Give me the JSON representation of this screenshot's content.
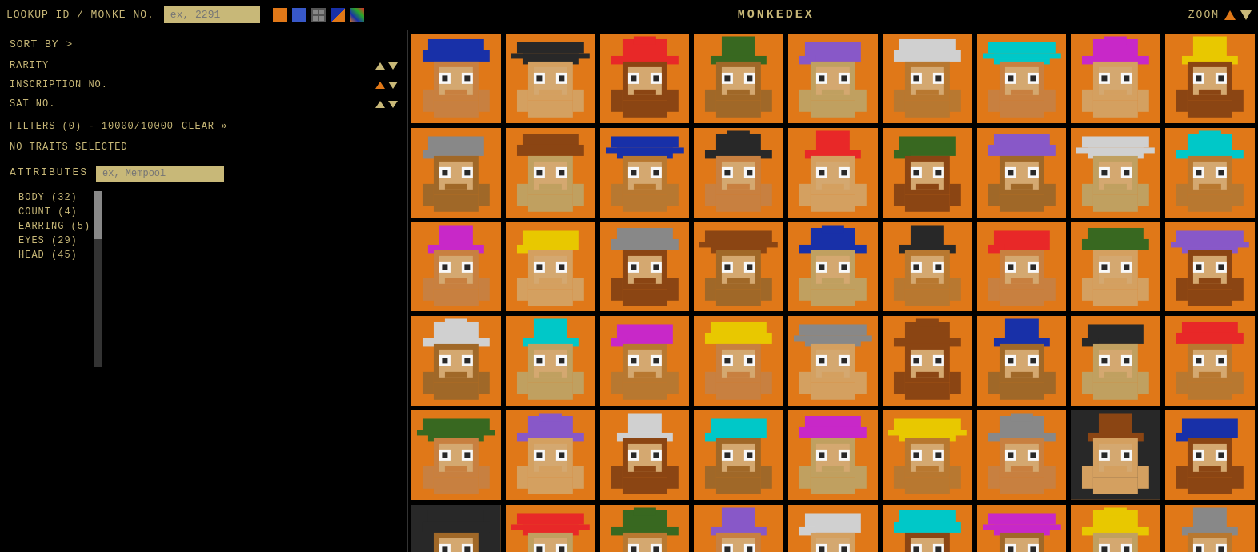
{
  "header": {
    "lookup_label": "LOOKUP ID / MONKE NO.",
    "lookup_placeholder": "ex, 2291",
    "monkedex_label": "MONKEDEX",
    "zoom_label": "ZOOM",
    "icons": [
      {
        "name": "orange-square-icon",
        "type": "orange"
      },
      {
        "name": "blue-square-icon",
        "type": "blue"
      },
      {
        "name": "grid-icon",
        "type": "grid"
      },
      {
        "name": "blue-orange-icon",
        "type": "colorful"
      },
      {
        "name": "multi-color-icon",
        "type": "multi"
      }
    ]
  },
  "sidebar": {
    "sort_by_label": "SORT BY >",
    "sort_items": [
      {
        "label": "RARITY",
        "has_orange_up": true
      },
      {
        "label": "INSCRIPTION NO.",
        "has_orange_up": true
      },
      {
        "label": "SAT NO.",
        "has_orange_up": false
      }
    ],
    "filters_label": "FILTERS (0) - 10000/10000",
    "clear_label": "Clear »",
    "no_traits_label": "NO TRAITS SELECTED",
    "attributes_label": "ATTRIBUTES",
    "attr_placeholder": "ex, Mempool",
    "attr_items": [
      {
        "label": "BODY (32)"
      },
      {
        "label": "COUNT (4)"
      },
      {
        "label": "EARRING (5)"
      },
      {
        "label": "EYES (29)"
      },
      {
        "label": "HEAD (45)"
      }
    ]
  },
  "grid": {
    "cells": [
      {
        "id": 1,
        "bg": "#e07818",
        "hat_color": "#1830a8",
        "body_color": "#8b4513"
      },
      {
        "id": 2,
        "bg": "#e07818",
        "hat_color": "#d0d0d0",
        "body_color": "#d4a060"
      },
      {
        "id": 3,
        "bg": "#e07818",
        "hat_color": "#282828",
        "body_color": "#8b6020"
      },
      {
        "id": 4,
        "bg": "#e07818",
        "hat_color": "#000000",
        "body_color": "#c88040"
      },
      {
        "id": 5,
        "bg": "#e07818",
        "hat_color": "#2838a8",
        "body_color": "#a0a0a0"
      },
      {
        "id": 6,
        "bg": "#e07818",
        "hat_color": "#d4a060",
        "body_color": "#c88040"
      },
      {
        "id": 7,
        "bg": "#e07818",
        "hat_color": "#f8d800",
        "body_color": "#c88040"
      },
      {
        "id": 8,
        "bg": "#e07818",
        "hat_color": "#888888",
        "body_color": "#c0c0c0"
      },
      {
        "id": 9,
        "bg": "#e07818",
        "hat_color": "#282828",
        "body_color": "#282828"
      },
      {
        "id": 10,
        "bg": "#e07818",
        "hat_color": "#d0d0d0",
        "body_color": "#00c8c8"
      },
      {
        "id": 11,
        "bg": "#e07818",
        "hat_color": "#1830a8",
        "body_color": "#1830a8"
      },
      {
        "id": 12,
        "bg": "#e07818",
        "hat_color": "#386820",
        "body_color": "#8b6020"
      },
      {
        "id": 13,
        "bg": "#e07818",
        "hat_color": "#d07040",
        "body_color": "#8b4513"
      },
      {
        "id": 14,
        "bg": "#e07818",
        "hat_color": "#1830a8",
        "body_color": "#e82828"
      },
      {
        "id": 15,
        "bg": "#e07818",
        "hat_color": "#c828c8",
        "body_color": "#c828c8"
      },
      {
        "id": 16,
        "bg": "#e07818",
        "hat_color": "#1830a8",
        "body_color": "#282828"
      },
      {
        "id": 17,
        "bg": "#e07818",
        "hat_color": "#e07818",
        "body_color": "#286828"
      },
      {
        "id": 18,
        "bg": "#e07818",
        "hat_color": "#1830a8",
        "body_color": "#1830a8"
      },
      {
        "id": 19,
        "bg": "#e07818",
        "hat_color": "#8858c8",
        "body_color": "#386820"
      },
      {
        "id": 20,
        "bg": "#e07818",
        "hat_color": "#282828",
        "body_color": "#8b4513"
      },
      {
        "id": 21,
        "bg": "#e07818",
        "hat_color": "#e82828",
        "body_color": "#c88040"
      },
      {
        "id": 22,
        "bg": "#e07818",
        "hat_color": "#c8a800",
        "body_color": "#8b6020"
      },
      {
        "id": 23,
        "bg": "#e07818",
        "hat_color": "#d0d0d0",
        "body_color": "#c0c0c0"
      },
      {
        "id": 24,
        "bg": "#e07818",
        "hat_color": "#d07040",
        "body_color": "#d4a060"
      },
      {
        "id": 25,
        "bg": "#e07818",
        "hat_color": "#1830a8",
        "body_color": "#e07818"
      },
      {
        "id": 26,
        "bg": "#e07818",
        "hat_color": "#8858c8",
        "body_color": "#386820"
      },
      {
        "id": 27,
        "bg": "#e07818",
        "hat_color": "#c8b878",
        "body_color": "#c88040"
      },
      {
        "id": 28,
        "bg": "#e07818",
        "hat_color": "#e82828",
        "body_color": "#386820"
      },
      {
        "id": 29,
        "bg": "#e07818",
        "hat_color": "#282828",
        "body_color": "#282828"
      },
      {
        "id": 30,
        "bg": "#e07818",
        "hat_color": "#c828c8",
        "body_color": "#286828"
      },
      {
        "id": 31,
        "bg": "#e07818",
        "hat_color": "#00a800",
        "body_color": "#386820"
      },
      {
        "id": 32,
        "bg": "#e07818",
        "hat_color": "#8b4513",
        "body_color": "#c88040"
      },
      {
        "id": 33,
        "bg": "#e07818",
        "hat_color": "#e82828",
        "body_color": "#282828"
      },
      {
        "id": 34,
        "bg": "#e07818",
        "hat_color": "#d0d0d0",
        "body_color": "#d4a060"
      },
      {
        "id": 35,
        "bg": "#e07818",
        "hat_color": "#e82828",
        "body_color": "#c828c8"
      },
      {
        "id": 36,
        "bg": "#e07818",
        "hat_color": "#1830a8",
        "body_color": "#1830a8"
      },
      {
        "id": 37,
        "bg": "#e07818",
        "hat_color": "#e8c800",
        "body_color": "#8858c8"
      },
      {
        "id": 38,
        "bg": "#e07818",
        "hat_color": "#282828",
        "body_color": "#386820"
      },
      {
        "id": 39,
        "bg": "#e07818",
        "hat_color": "#1830a8",
        "body_color": "#c88040"
      },
      {
        "id": 40,
        "bg": "#e07818",
        "hat_color": "#8b4513",
        "body_color": "#8b4513"
      },
      {
        "id": 41,
        "bg": "#e07818",
        "hat_color": "#e8c800",
        "body_color": "#8858c8"
      },
      {
        "id": 42,
        "bg": "#e07818",
        "hat_color": "#282828",
        "body_color": "#386820"
      },
      {
        "id": 43,
        "bg": "#e07818",
        "hat_color": "#1830a8",
        "body_color": "#282828"
      },
      {
        "id": 44,
        "bg": "#282828",
        "hat_color": "#c828c8",
        "body_color": "#c88040"
      },
      {
        "id": 45,
        "bg": "#e07818",
        "hat_color": "#e82828",
        "body_color": "#8b4513"
      },
      {
        "id": 46,
        "bg": "#282828",
        "hat_color": "#282828",
        "body_color": "#286828"
      },
      {
        "id": 47,
        "bg": "#e07818",
        "hat_color": "#1830a8",
        "body_color": "#c88040"
      },
      {
        "id": 48,
        "bg": "#e07818",
        "hat_color": "#d0d0d0",
        "body_color": "#c88040"
      },
      {
        "id": 49,
        "bg": "#e07818",
        "hat_color": "#c88040",
        "body_color": "#c88040"
      },
      {
        "id": 50,
        "bg": "#e07818",
        "hat_color": "#d4a060",
        "body_color": "#c88040"
      },
      {
        "id": 51,
        "bg": "#e07818",
        "hat_color": "#282828",
        "body_color": "#282828"
      },
      {
        "id": 52,
        "bg": "#e07818",
        "hat_color": "#e07818",
        "body_color": "#c88040"
      },
      {
        "id": 53,
        "bg": "#e07818",
        "hat_color": "#e8c800",
        "body_color": "#c8b878"
      },
      {
        "id": 54,
        "bg": "#e07818",
        "hat_color": "#282828",
        "body_color": "#1830a8"
      }
    ]
  }
}
